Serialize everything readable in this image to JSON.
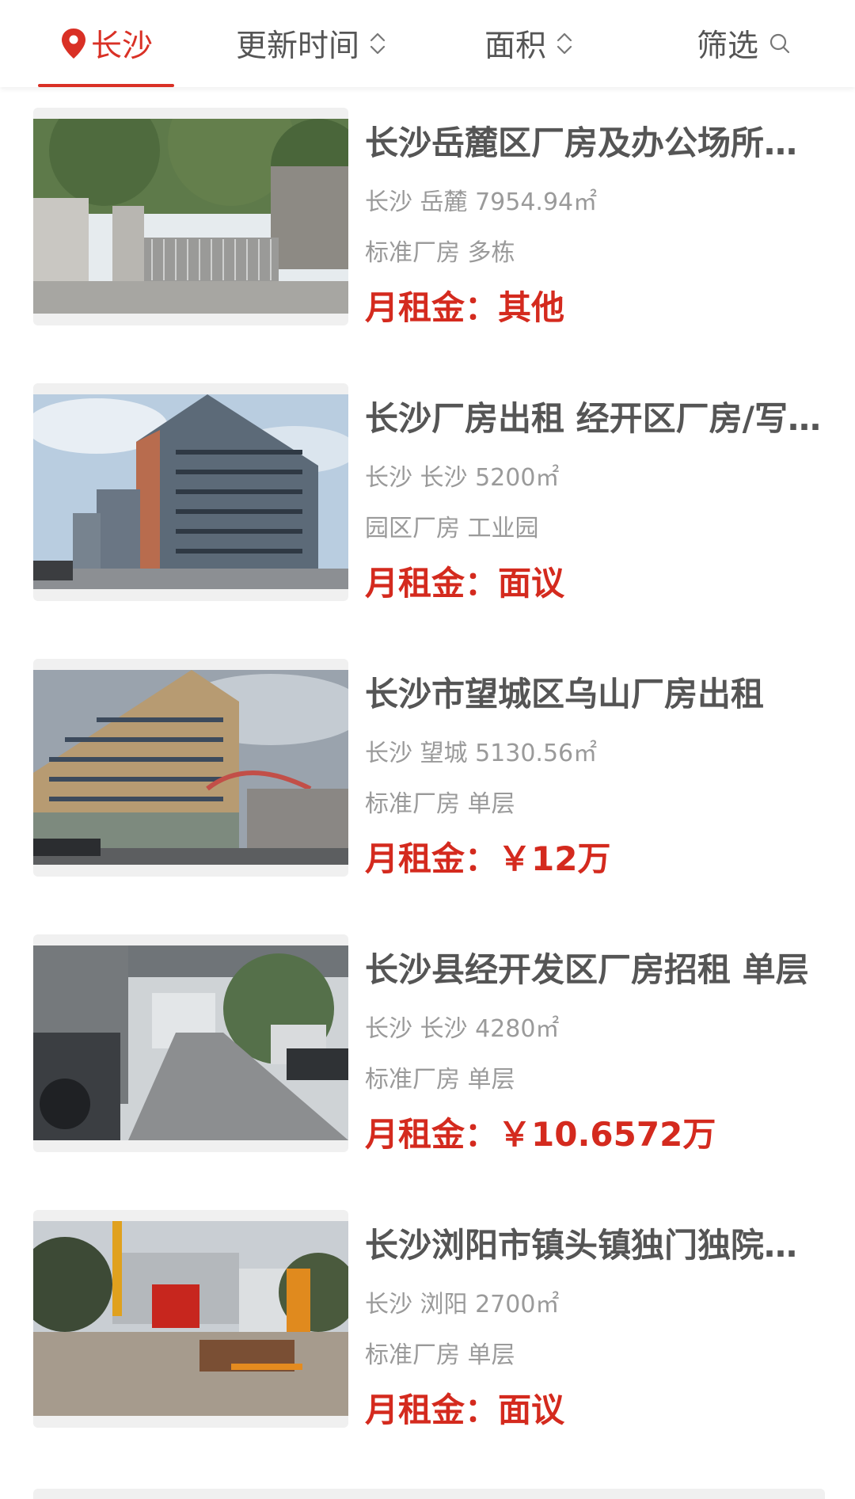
{
  "filters": {
    "city": "长沙",
    "update_time": "更新时间",
    "area": "面积",
    "filter": "筛选"
  },
  "icons": {
    "pin": "location-pin-icon",
    "sort": "sort-arrows-icon",
    "search": "search-icon"
  },
  "colors": {
    "accent": "#d93025",
    "price": "#d42a1e"
  },
  "listings": [
    {
      "title": "长沙岳麓区厂房及办公场所出租",
      "location": "长沙 岳麓 7954.94㎡",
      "type": "标准厂房 多栋",
      "price_label": "月租金：",
      "price_value": "其他"
    },
    {
      "title": "长沙厂房出租 经开区厂房/写字楼",
      "location": "长沙 长沙 5200㎡",
      "type": "园区厂房 工业园",
      "price_label": "月租金：",
      "price_value": "面议"
    },
    {
      "title": "长沙市望城区乌山厂房出租",
      "location": "长沙 望城 5130.56㎡",
      "type": "标准厂房 单层",
      "price_label": "月租金：",
      "price_value": "￥12万"
    },
    {
      "title": "长沙县经开发区厂房招租 单层",
      "location": "长沙 长沙 4280㎡",
      "type": "标准厂房 单层",
      "price_label": "月租金：",
      "price_value": "￥10.6572万"
    },
    {
      "title": "长沙浏阳市镇头镇独门独院厂房",
      "location": "长沙 浏阳 2700㎡",
      "type": "标准厂房 单层",
      "price_label": "月租金：",
      "price_value": "面议"
    }
  ]
}
